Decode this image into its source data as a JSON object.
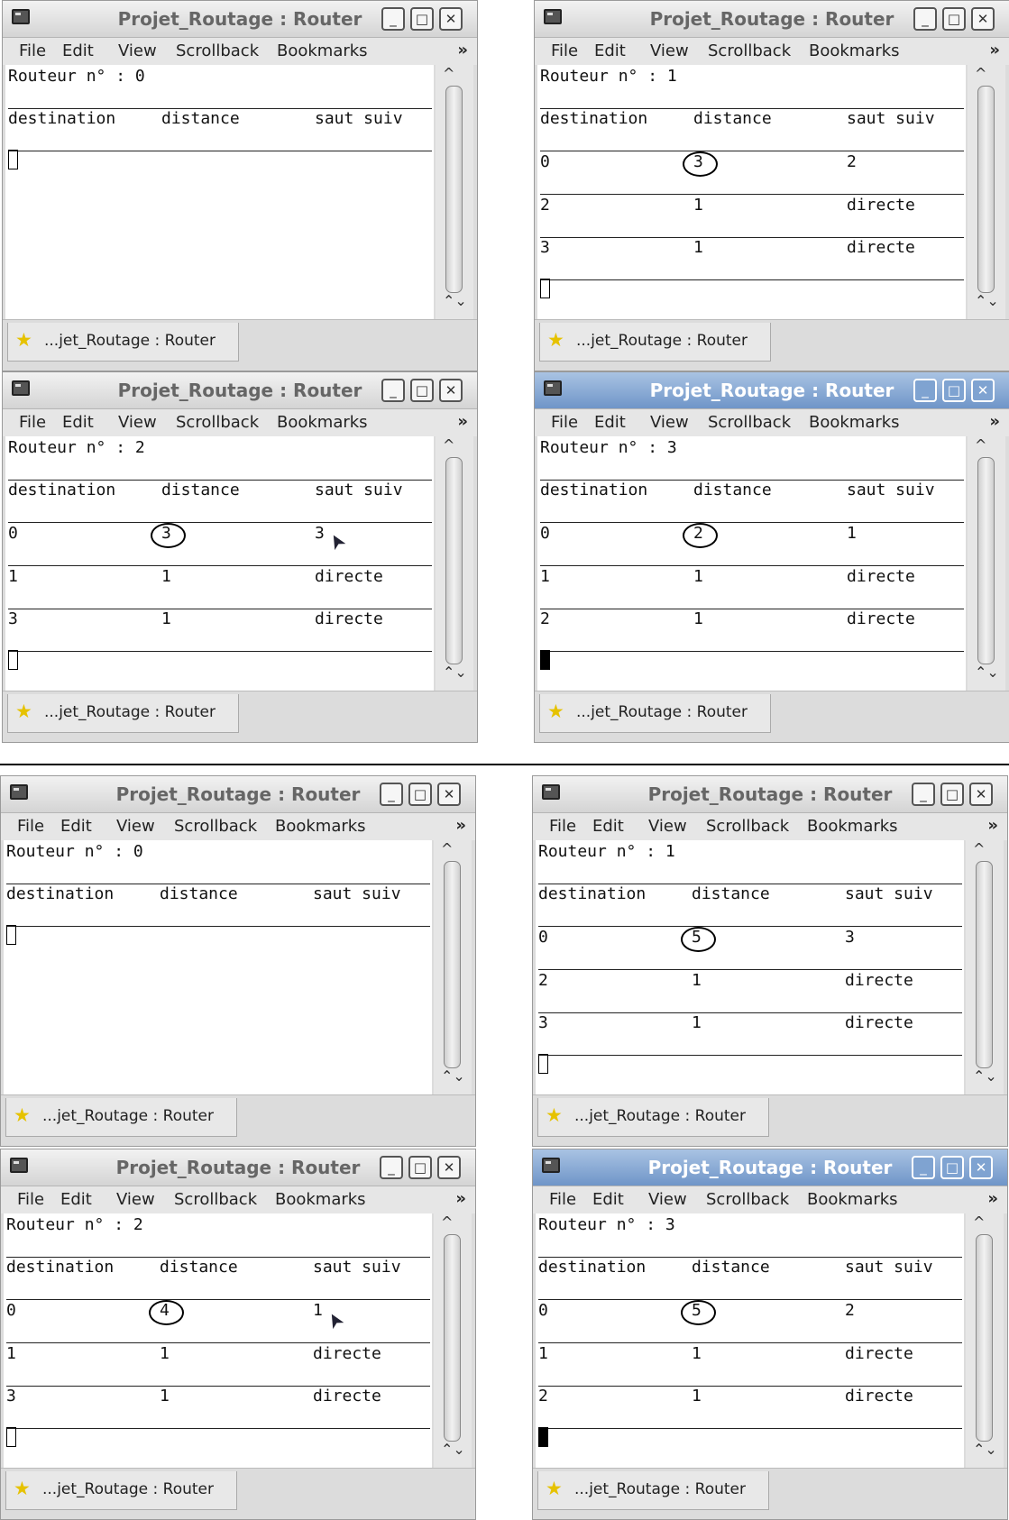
{
  "window": {
    "title": "Projet_Routage : Router",
    "menu": [
      "File",
      "Edit",
      "View",
      "Scrollback",
      "Bookmarks"
    ],
    "menu_more": "»",
    "tab_label": "...jet_Routage : Router",
    "buttons": {
      "minimize": "_",
      "maximize": "□",
      "close": "✕"
    },
    "scroll_up": "^",
    "scroll_down": "⌃⌄"
  },
  "table_headers": {
    "dest": "destination",
    "dist": "distance",
    "next": "saut suiv"
  },
  "panels": [
    {
      "router_line": "Routeur n° : 0",
      "rows": []
    },
    {
      "router_line": "Routeur n° : 1",
      "rows": [
        {
          "dest": "0",
          "dist": "3",
          "next": "2"
        },
        {
          "dest": "2",
          "dist": "1",
          "next": "directe"
        },
        {
          "dest": "3",
          "dist": "1",
          "next": "directe"
        }
      ]
    },
    {
      "router_line": "Routeur n° : 2",
      "rows": [
        {
          "dest": "0",
          "dist": "3",
          "next": "3"
        },
        {
          "dest": "1",
          "dist": "1",
          "next": "directe"
        },
        {
          "dest": "3",
          "dist": "1",
          "next": "directe"
        }
      ]
    },
    {
      "router_line": "Routeur n° : 3",
      "rows": [
        {
          "dest": "0",
          "dist": "2",
          "next": "1"
        },
        {
          "dest": "1",
          "dist": "1",
          "next": "directe"
        },
        {
          "dest": "2",
          "dist": "1",
          "next": "directe"
        }
      ]
    },
    {
      "router_line": "Routeur n° : 0",
      "rows": []
    },
    {
      "router_line": "Routeur n° : 1",
      "rows": [
        {
          "dest": "0",
          "dist": "5",
          "next": "3"
        },
        {
          "dest": "2",
          "dist": "1",
          "next": "directe"
        },
        {
          "dest": "3",
          "dist": "1",
          "next": "directe"
        }
      ]
    },
    {
      "router_line": "Routeur n° : 2",
      "rows": [
        {
          "dest": "0",
          "dist": "4",
          "next": "1"
        },
        {
          "dest": "1",
          "dist": "1",
          "next": "directe"
        },
        {
          "dest": "3",
          "dist": "1",
          "next": "directe"
        }
      ]
    },
    {
      "router_line": "Routeur n° : 3",
      "rows": [
        {
          "dest": "0",
          "dist": "5",
          "next": "2"
        },
        {
          "dest": "1",
          "dist": "1",
          "next": "directe"
        },
        {
          "dest": "2",
          "dist": "1",
          "next": "directe"
        }
      ]
    }
  ]
}
